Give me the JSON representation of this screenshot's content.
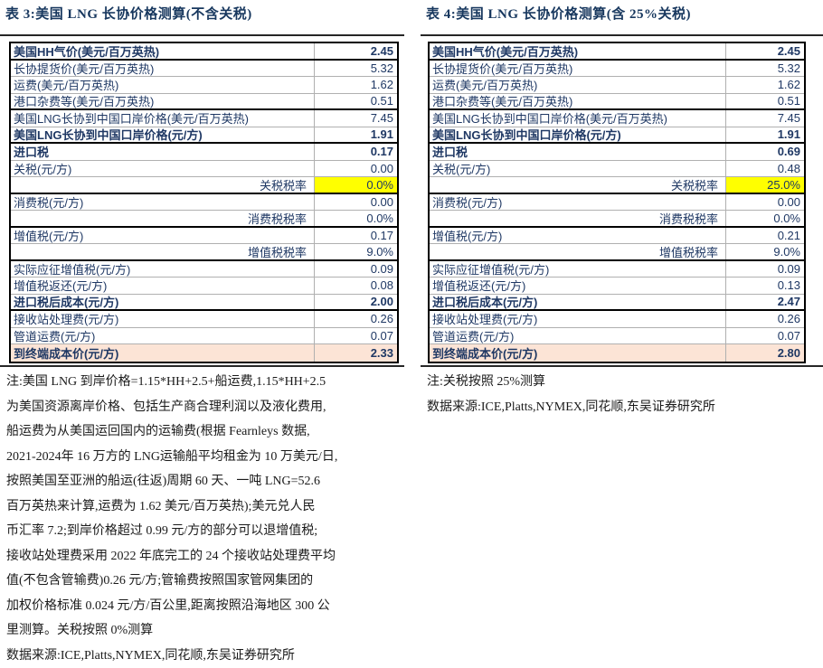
{
  "colors": {
    "title_text": "#17375e",
    "table_text": "#1f3864",
    "tariff_rate_highlight": "#ffff00",
    "terminal_cost_highlight": "#fce4d6"
  },
  "tables": [
    {
      "title": "表 3:美国 LNG 长协价格测算(不含关税)",
      "rows": [
        {
          "label": "美国HH气价(美元/百万英热)",
          "value": "2.45",
          "em": true,
          "section_end": true
        },
        {
          "label": "长协提货价(美元/百万英热)",
          "value": "5.32"
        },
        {
          "label": "运费(美元/百万英热)",
          "value": "1.62"
        },
        {
          "label": "港口杂费等(美元/百万英热)",
          "value": "0.51",
          "section_end": true
        },
        {
          "label": "美国LNG长协到中国口岸价格(美元/百万英热)",
          "value": "7.45"
        },
        {
          "label": "美国LNG长协到中国口岸价格(元/方)",
          "value": "1.91",
          "em": true,
          "section_end": true
        },
        {
          "label": "进口税",
          "value": "0.17",
          "em": true
        },
        {
          "label": "关税(元/方)",
          "value": "0.00"
        },
        {
          "label": "关税税率",
          "value": "0.0%",
          "label_align": "right",
          "value_bg": "#ffff00",
          "section_end": true
        },
        {
          "label": "消费税(元/方)",
          "value": "0.00"
        },
        {
          "label": "消费税税率",
          "value": "0.0%",
          "label_align": "right",
          "section_end": true
        },
        {
          "label": "增值税(元/方)",
          "value": "0.17"
        },
        {
          "label": "增值税税率",
          "value": "9.0%",
          "label_align": "right",
          "section_end": true
        },
        {
          "label": "实际应征增值税(元/方)",
          "value": "0.09"
        },
        {
          "label": "增值税返还(元/方)",
          "value": "0.08"
        },
        {
          "label": "进口税后成本(元/方)",
          "value": "2.00",
          "em": true,
          "section_end": true
        },
        {
          "label": "接收站处理费(元/方)",
          "value": "0.26"
        },
        {
          "label": "管道运费(元/方)",
          "value": "0.07"
        },
        {
          "label": "到终端成本价(元/方)",
          "value": "2.33",
          "em": true,
          "row_bg": "#fce4d6"
        }
      ],
      "notes": [
        "注:美国 LNG 到岸价格=1.15*HH+2.5+船运费,1.15*HH+2.5",
        "为美国资源离岸价格、包括生产商合理利润以及液化费用,",
        "船运费为从美国运回国内的运输费(根据 Fearnleys 数据,",
        "2021-2024年 16 万方的 LNG运输船平均租金为 10 万美元/日,",
        "按照美国至亚洲的船运(往返)周期 60 天、一吨 LNG=52.6",
        "百万英热来计算,运费为 1.62 美元/百万英热);美元兑人民",
        "币汇率 7.2;到岸价格超过 0.99 元/方的部分可以退增值税;",
        "接收站处理费采用 2022 年底完工的 24 个接收站处理费平均",
        "值(不包含管输费)0.26 元/方;管输费按照国家管网集团的",
        "加权价格标准 0.024 元/方/百公里,距离按照沿海地区 300 公",
        "里测算。关税按照 0%测算",
        "数据来源:ICE,Platts,NYMEX,同花顺,东吴证券研究所"
      ]
    },
    {
      "title": "表 4:美国 LNG 长协价格测算(含 25%关税)",
      "rows": [
        {
          "label": "美国HH气价(美元/百万英热)",
          "value": "2.45",
          "em": true,
          "section_end": true
        },
        {
          "label": "长协提货价(美元/百万英热)",
          "value": "5.32"
        },
        {
          "label": "运费(美元/百万英热)",
          "value": "1.62"
        },
        {
          "label": "港口杂费等(美元/百万英热)",
          "value": "0.51",
          "section_end": true
        },
        {
          "label": "美国LNG长协到中国口岸价格(美元/百万英热)",
          "value": "7.45"
        },
        {
          "label": "美国LNG长协到中国口岸价格(元/方)",
          "value": "1.91",
          "em": true,
          "section_end": true
        },
        {
          "label": "进口税",
          "value": "0.69",
          "em": true
        },
        {
          "label": "关税(元/方)",
          "value": "0.48"
        },
        {
          "label": "关税税率",
          "value": "25.0%",
          "label_align": "right",
          "value_bg": "#ffff00",
          "section_end": true
        },
        {
          "label": "消费税(元/方)",
          "value": "0.00"
        },
        {
          "label": "消费税税率",
          "value": "0.0%",
          "label_align": "right",
          "section_end": true
        },
        {
          "label": "增值税(元/方)",
          "value": "0.21"
        },
        {
          "label": "增值税税率",
          "value": "9.0%",
          "label_align": "right",
          "section_end": true
        },
        {
          "label": "实际应征增值税(元/方)",
          "value": "0.09"
        },
        {
          "label": "增值税返还(元/方)",
          "value": "0.13"
        },
        {
          "label": "进口税后成本(元/方)",
          "value": "2.47",
          "em": true,
          "section_end": true
        },
        {
          "label": "接收站处理费(元/方)",
          "value": "0.26"
        },
        {
          "label": "管道运费(元/方)",
          "value": "0.07"
        },
        {
          "label": "到终端成本价(元/方)",
          "value": "2.80",
          "em": true,
          "row_bg": "#fce4d6"
        }
      ],
      "notes": [
        "注:关税按照 25%测算",
        "数据来源:ICE,Platts,NYMEX,同花顺,东吴证券研究所"
      ]
    }
  ]
}
